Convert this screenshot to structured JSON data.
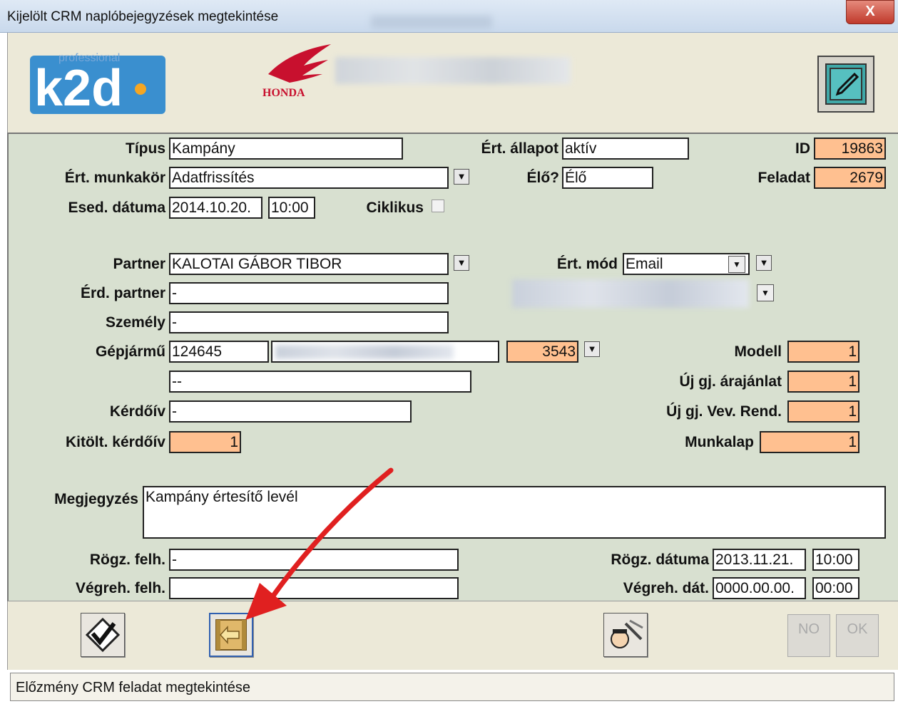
{
  "window": {
    "title": "Kijelölt CRM naplóbejegyzések megtekintése",
    "close_label": "X"
  },
  "header": {
    "logo_text": "professional",
    "logo_main": "k2d",
    "brand": "HONDA"
  },
  "form": {
    "tipus": {
      "label": "Típus",
      "value": "Kampány"
    },
    "ert_allapot": {
      "label": "Ért. állapot",
      "value": "aktív"
    },
    "id": {
      "label": "ID",
      "value": "19863"
    },
    "ert_munkakor": {
      "label": "Ért. munkakör",
      "value": "Adatfrissítés"
    },
    "elo": {
      "label": "Élő?",
      "value": "Élő"
    },
    "feladat": {
      "label": "Feladat",
      "value": "2679"
    },
    "esed_datuma": {
      "label": "Esed. dátuma",
      "date": "2014.10.20.",
      "time": "10:00"
    },
    "ciklikus": {
      "label": "Ciklikus",
      "checked": false
    },
    "partner": {
      "label": "Partner",
      "value": "KALOTAI GÁBOR TIBOR"
    },
    "ert_mod": {
      "label": "Ért. mód",
      "value": "Email"
    },
    "erd_partner": {
      "label": "Érd. partner",
      "value": "-"
    },
    "szemely": {
      "label": "Személy",
      "value": "-"
    },
    "gepjarmu": {
      "label": "Gépjármű",
      "value": "124645",
      "number": "3543",
      "line2": "--"
    },
    "modell": {
      "label": "Modell",
      "value": "1"
    },
    "uj_arajanlat": {
      "label": "Új gj. árajánlat",
      "value": "1"
    },
    "kerdoiv": {
      "label": "Kérdőív",
      "value": "-"
    },
    "uj_vev_rend": {
      "label": "Új gj. Vev. Rend.",
      "value": "1"
    },
    "kitolt_kerdoiv": {
      "label": "Kitölt. kérdőív",
      "value": "1"
    },
    "munkalap": {
      "label": "Munkalap",
      "value": "1"
    },
    "megjegyzes": {
      "label": "Megjegyzés",
      "value": "Kampány értesítő levél"
    },
    "rogz_felh": {
      "label": "Rögz. felh.",
      "value": "-"
    },
    "rogz_datuma": {
      "label": "Rögz. dátuma",
      "date": "2013.11.21.",
      "time": "10:00"
    },
    "vegreh_felh": {
      "label": "Végreh. felh.",
      "value": ""
    },
    "vegreh_dat": {
      "label": "Végreh. dát.",
      "date": "0000.00.00.",
      "time": "00:00"
    }
  },
  "footer": {
    "no_label": "NO",
    "ok_label": "OK"
  },
  "status": {
    "text": "Előzmény CRM feladat megtekintése"
  },
  "colors": {
    "accent_orange": "#ffc090",
    "form_bg": "#d8e0d0",
    "arrow_red": "#e02020"
  }
}
